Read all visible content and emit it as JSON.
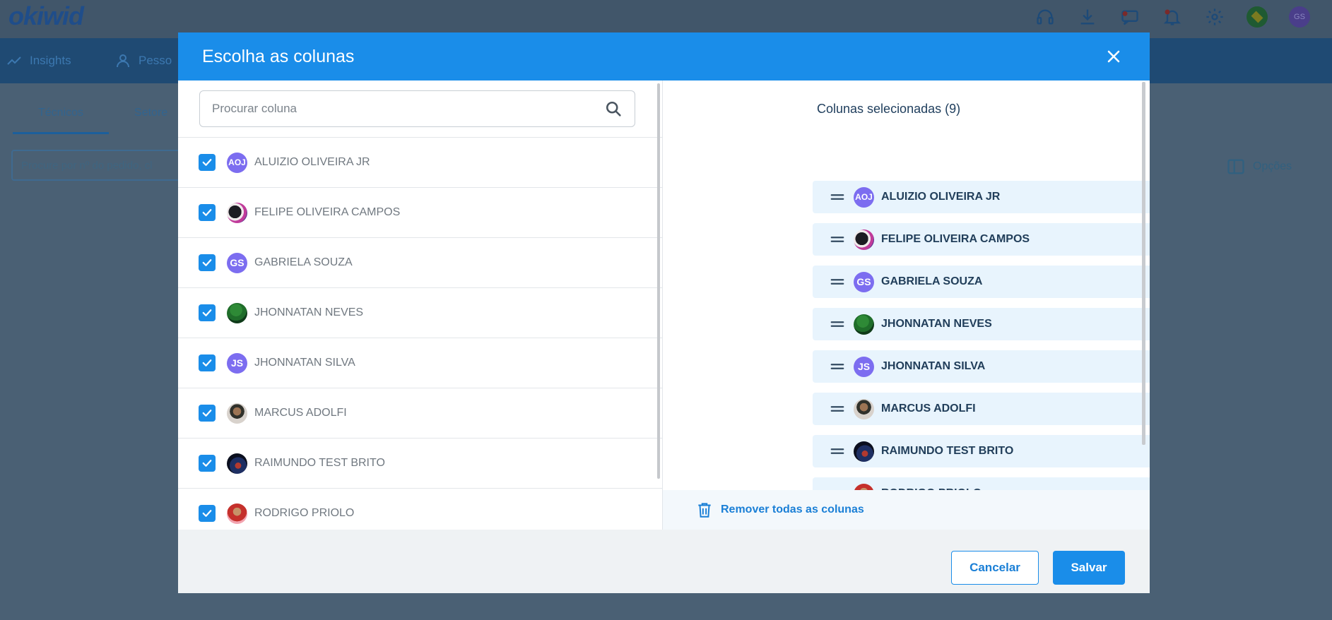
{
  "app": {
    "logo": "okiwid",
    "nav": [
      {
        "label": "Insights",
        "icon": "trend-icon"
      },
      {
        "label": "Pesso",
        "icon": "person-icon"
      }
    ],
    "tabs": [
      "Técnicos",
      "Setore"
    ],
    "search_placeholder": "Procure por nº do pedido, cl",
    "options_label": "Opções",
    "user_initials": "GS"
  },
  "modal": {
    "title": "Escolha as colunas",
    "search_placeholder": "Procurar coluna",
    "selected_title": "Colunas selecionadas (9)",
    "remove_all_label": "Remover todas as colunas",
    "cancel_label": "Cancelar",
    "save_label": "Salvar"
  },
  "candidates": [
    {
      "name": "ALUIZIO OLIVEIRA JR",
      "initials": "AOJ",
      "avatar": "initials",
      "checked": true
    },
    {
      "name": "FELIPE OLIVEIRA CAMPOS",
      "initials": "",
      "avatar": "felipe",
      "checked": true
    },
    {
      "name": "GABRIELA SOUZA",
      "initials": "GS",
      "avatar": "initials",
      "checked": true
    },
    {
      "name": "JHONNATAN NEVES",
      "initials": "",
      "avatar": "jhon",
      "checked": true
    },
    {
      "name": "JHONNATAN SILVA",
      "initials": "JS",
      "avatar": "initials",
      "checked": true
    },
    {
      "name": "MARCUS ADOLFI",
      "initials": "",
      "avatar": "marcus",
      "checked": true
    },
    {
      "name": "RAIMUNDO TEST BRITO",
      "initials": "",
      "avatar": "raimundo",
      "checked": true
    },
    {
      "name": "RODRIGO PRIOLO",
      "initials": "",
      "avatar": "rodrigo",
      "checked": true
    }
  ],
  "selected": [
    {
      "name": "ALUIZIO OLIVEIRA JR",
      "initials": "AOJ",
      "avatar": "initials"
    },
    {
      "name": "FELIPE OLIVEIRA CAMPOS",
      "initials": "",
      "avatar": "felipe"
    },
    {
      "name": "GABRIELA SOUZA",
      "initials": "GS",
      "avatar": "initials"
    },
    {
      "name": "JHONNATAN NEVES",
      "initials": "",
      "avatar": "jhon"
    },
    {
      "name": "JHONNATAN SILVA",
      "initials": "JS",
      "avatar": "initials"
    },
    {
      "name": "MARCUS ADOLFI",
      "initials": "",
      "avatar": "marcus"
    },
    {
      "name": "RAIMUNDO TEST BRITO",
      "initials": "",
      "avatar": "raimundo"
    },
    {
      "name": "RODRIGO PRIOLO",
      "initials": "",
      "avatar": "rodrigo"
    }
  ],
  "colors": {
    "accent": "#1a8de9",
    "selected_bg": "#e8f4fd",
    "overlay": "#4a6074"
  }
}
